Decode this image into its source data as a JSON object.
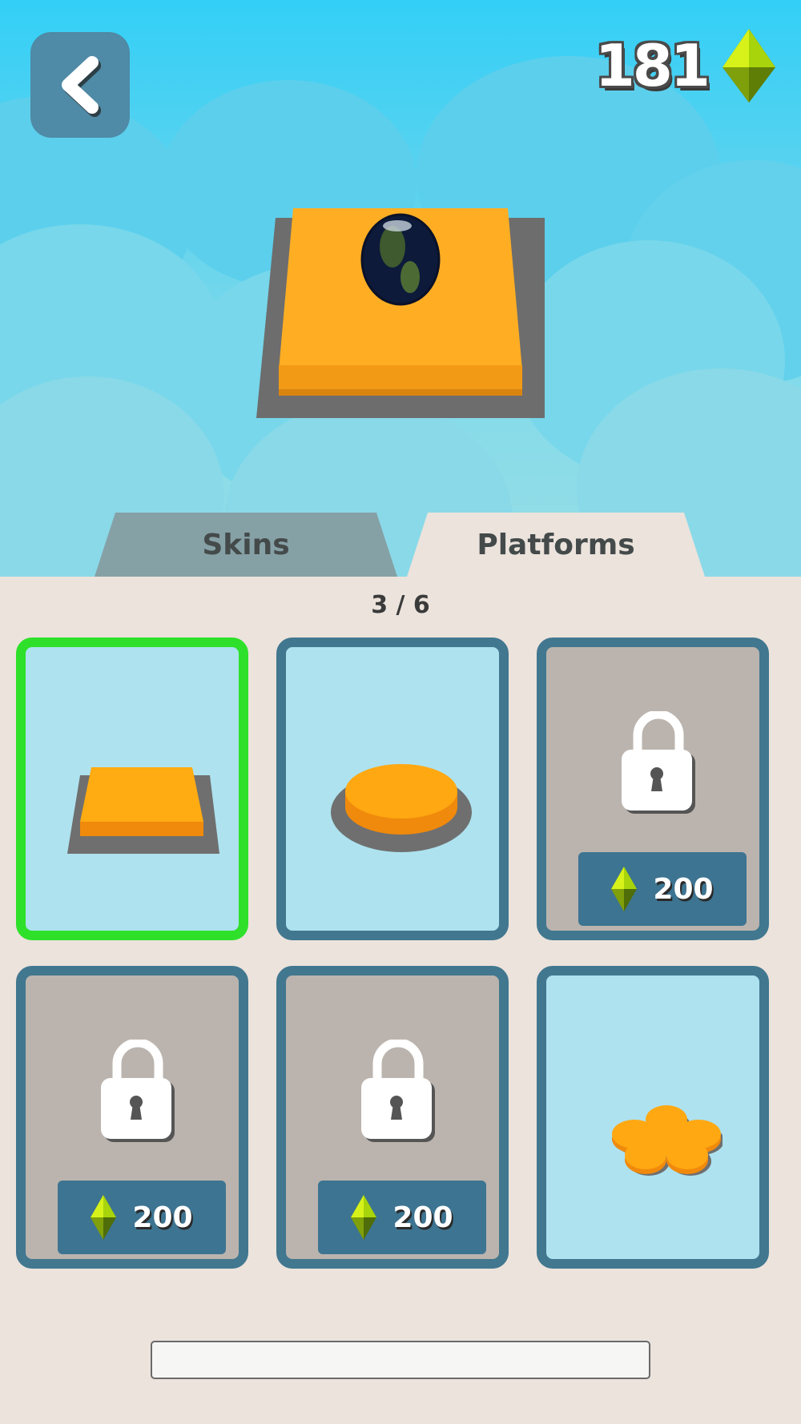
{
  "header": {
    "gem_count": "181",
    "back_icon": "chevron-left-icon",
    "gem_icon": "gem-icon",
    "colors": {
      "gem": "#c6ef16",
      "back_button": "#4f8aa6"
    }
  },
  "tabs": [
    {
      "label": "Skins",
      "active": false
    },
    {
      "label": "Platforms",
      "active": true
    }
  ],
  "page_indicator": "3 / 6",
  "items": [
    {
      "type": "square-platform",
      "state": "selected",
      "color": "#ffa50f"
    },
    {
      "type": "round-platform",
      "state": "unlocked",
      "color": "#ffa50f"
    },
    {
      "type": "locked",
      "state": "locked",
      "price": "200",
      "icon": "lock-icon"
    },
    {
      "type": "locked",
      "state": "locked",
      "price": "200",
      "icon": "lock-icon"
    },
    {
      "type": "locked",
      "state": "locked",
      "price": "200",
      "icon": "lock-icon"
    },
    {
      "type": "flower-platform",
      "state": "unlocked",
      "color": "#ffa50f"
    }
  ],
  "colors": {
    "panel": "#ebe3dc",
    "card_border": "#41778f",
    "card_selected_border": "#2ee02a",
    "card_unlocked_bg": "#aee2ef",
    "card_locked_bg": "#bbb4ae",
    "price_button": "#3d7491"
  }
}
